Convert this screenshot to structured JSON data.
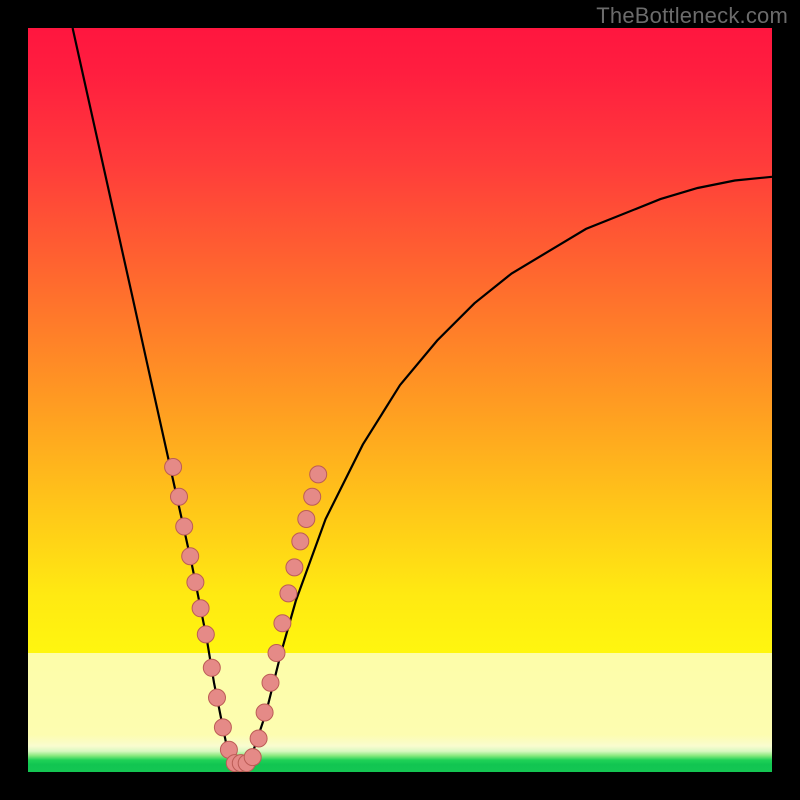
{
  "watermark": "TheBottleneck.com",
  "chart_data": {
    "type": "line",
    "title": "",
    "xlabel": "",
    "ylabel": "",
    "xlim": [
      0,
      100
    ],
    "ylim": [
      0,
      100
    ],
    "series": [
      {
        "name": "bottleneck-curve",
        "x": [
          6,
          8,
          10,
          12,
          14,
          16,
          18,
          20,
          22,
          24,
          25,
          26,
          27,
          28,
          29,
          30,
          32,
          34,
          36,
          40,
          45,
          50,
          55,
          60,
          65,
          70,
          75,
          80,
          85,
          90,
          95,
          100
        ],
        "values": [
          100,
          91,
          82,
          73,
          64,
          55,
          46,
          37,
          28,
          18,
          12,
          7,
          2,
          1,
          1,
          2,
          8,
          16,
          23,
          34,
          44,
          52,
          58,
          63,
          67,
          70,
          73,
          75,
          77,
          78.5,
          79.5,
          80
        ]
      }
    ],
    "markers": {
      "name": "dots",
      "color": "#e58a87",
      "outline": "#bc5c56",
      "points": [
        {
          "x": 19.5,
          "y": 41
        },
        {
          "x": 20.3,
          "y": 37
        },
        {
          "x": 21.0,
          "y": 33
        },
        {
          "x": 21.8,
          "y": 29
        },
        {
          "x": 22.5,
          "y": 25.5
        },
        {
          "x": 23.2,
          "y": 22
        },
        {
          "x": 23.9,
          "y": 18.5
        },
        {
          "x": 24.7,
          "y": 14
        },
        {
          "x": 25.4,
          "y": 10
        },
        {
          "x": 26.2,
          "y": 6
        },
        {
          "x": 27.0,
          "y": 3
        },
        {
          "x": 27.8,
          "y": 1.2
        },
        {
          "x": 28.6,
          "y": 1.2
        },
        {
          "x": 29.4,
          "y": 1.2
        },
        {
          "x": 30.2,
          "y": 2
        },
        {
          "x": 31.0,
          "y": 4.5
        },
        {
          "x": 31.8,
          "y": 8
        },
        {
          "x": 32.6,
          "y": 12
        },
        {
          "x": 33.4,
          "y": 16
        },
        {
          "x": 34.2,
          "y": 20
        },
        {
          "x": 35.0,
          "y": 24
        },
        {
          "x": 35.8,
          "y": 27.5
        },
        {
          "x": 36.6,
          "y": 31
        },
        {
          "x": 37.4,
          "y": 34
        },
        {
          "x": 38.2,
          "y": 37
        },
        {
          "x": 39.0,
          "y": 40
        }
      ]
    },
    "gradient_stops": [
      {
        "pos": 0.0,
        "color": "#ff163f"
      },
      {
        "pos": 0.5,
        "color": "#ff9a22"
      },
      {
        "pos": 0.8,
        "color": "#fff60f"
      },
      {
        "pos": 0.95,
        "color": "#fdfdb0"
      },
      {
        "pos": 0.99,
        "color": "#1fd157"
      }
    ]
  }
}
